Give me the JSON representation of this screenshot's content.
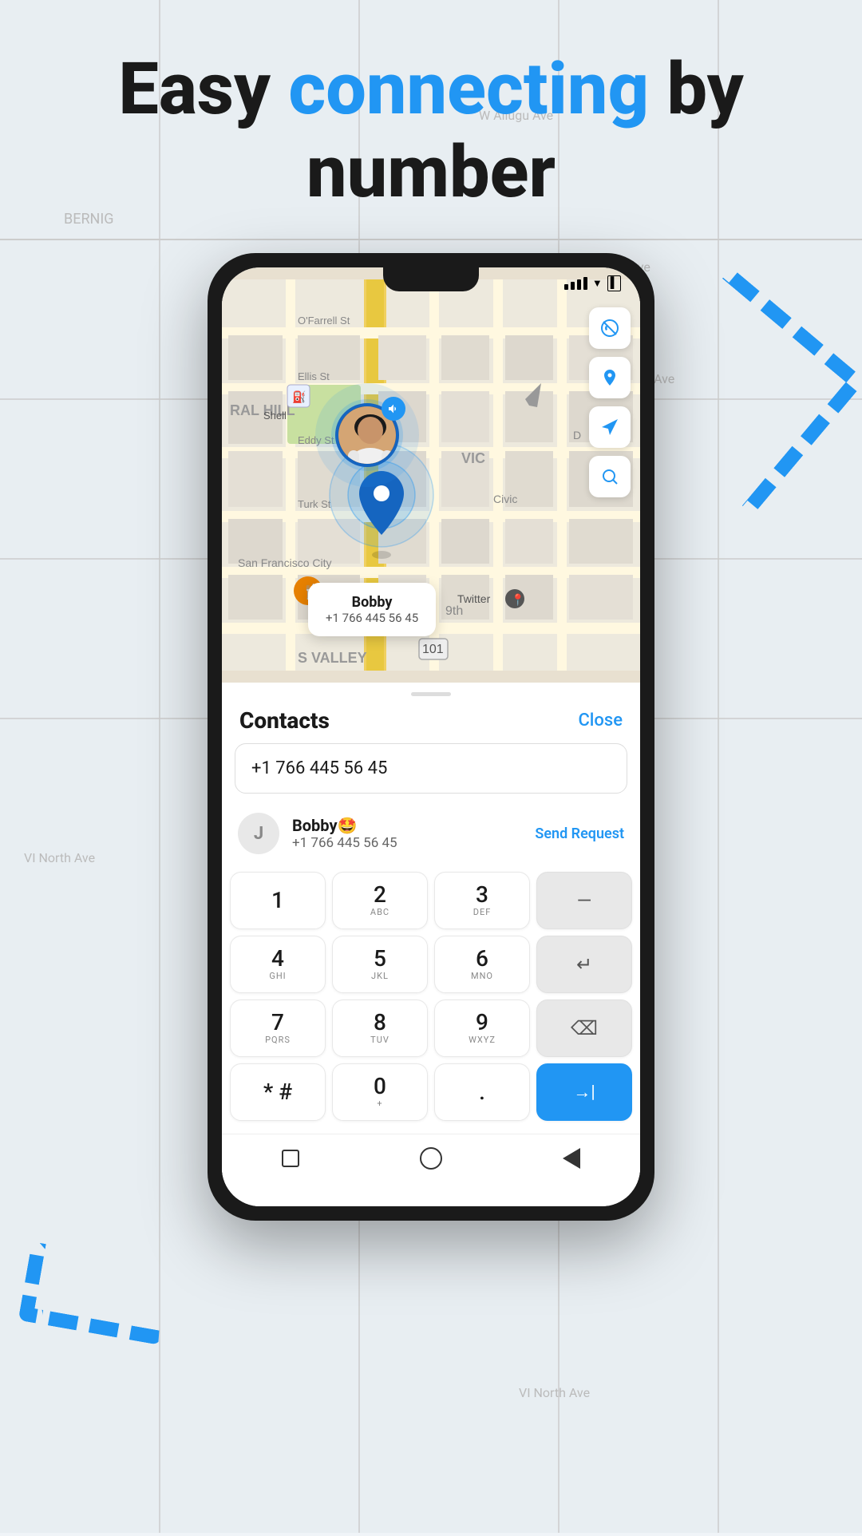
{
  "heading": {
    "part1": "Easy ",
    "accent": "connecting",
    "part2": " by",
    "line2": "number"
  },
  "map": {
    "location_name": "San Francisco City",
    "neighborhood": "RAL HILL",
    "street1": "Ellis St",
    "street2": "Eddy St",
    "street3": "Turk St",
    "poi1": "Shell",
    "route": "101",
    "district": "VIC",
    "street4": "9th",
    "buttons": {
      "mute": "🔕",
      "pin": "📍",
      "navigate": "➤",
      "search": "🔍"
    }
  },
  "popup": {
    "name": "Bobby",
    "phone": "+1 766 445 56 45"
  },
  "twitter_poi": {
    "label": "Twitter"
  },
  "contacts_panel": {
    "title": "Contacts",
    "close": "Close",
    "phone_input": "+1 766 445 56 45",
    "contact": {
      "avatar_letter": "J",
      "name": "Bobby🤩",
      "phone": "+1 766 445 56 45",
      "action": "Send Request"
    }
  },
  "dialpad": {
    "rows": [
      [
        {
          "number": "1",
          "letters": ""
        },
        {
          "number": "2",
          "letters": "ABC"
        },
        {
          "number": "3",
          "letters": "DEF"
        },
        {
          "number": "—",
          "letters": "",
          "type": "gray"
        }
      ],
      [
        {
          "number": "4",
          "letters": "GHI"
        },
        {
          "number": "5",
          "letters": "JKL"
        },
        {
          "number": "6",
          "letters": "MNO"
        },
        {
          "number": "↵",
          "letters": "",
          "type": "gray"
        }
      ],
      [
        {
          "number": "7",
          "letters": "PQRS"
        },
        {
          "number": "8",
          "letters": "TUV"
        },
        {
          "number": "9",
          "letters": "WXYZ"
        },
        {
          "number": "⌫",
          "letters": "",
          "type": "gray"
        }
      ],
      [
        {
          "number": "*#",
          "letters": ""
        },
        {
          "number": "0",
          "letters": "+"
        },
        {
          "number": ".",
          "letters": ""
        },
        {
          "number": "→|",
          "letters": "",
          "type": "blue"
        }
      ]
    ]
  },
  "navbar": {
    "items": [
      "square",
      "circle",
      "triangle"
    ]
  },
  "status_bar": {
    "time": "",
    "signal": true
  }
}
